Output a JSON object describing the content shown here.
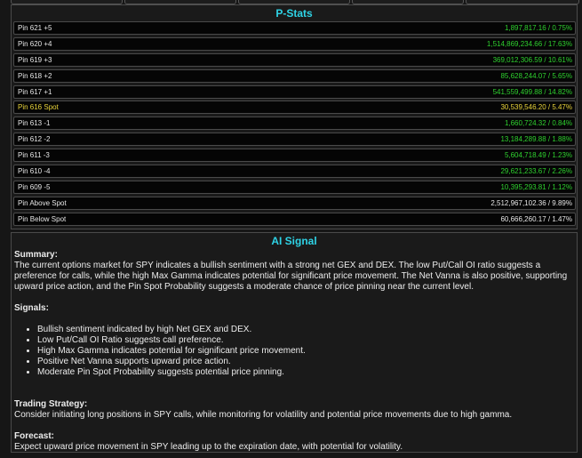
{
  "pstats": {
    "title": "P-Stats",
    "rows": [
      {
        "label": "Pin 621 +5",
        "value": "1,897,817.16 / 0.75%"
      },
      {
        "label": "Pin 620 +4",
        "value": "1,514,869,234.66 / 17.63%"
      },
      {
        "label": "Pin 619 +3",
        "value": "369,012,306.59 / 10.61%"
      },
      {
        "label": "Pin 618 +2",
        "value": "85,628,244.07 / 5.65%"
      },
      {
        "label": "Pin 617 +1",
        "value": "541,559,499.88 / 14.82%"
      },
      {
        "label": "Pin 616 Spot",
        "value": "30,539,546.20 / 5.47%"
      },
      {
        "label": "Pin 613 -1",
        "value": "1,660,724.32 / 0.84%"
      },
      {
        "label": "Pin 612 -2",
        "value": "13,184,289.88 / 1.88%"
      },
      {
        "label": "Pin 611 -3",
        "value": "5,604,718.49 / 1.23%"
      },
      {
        "label": "Pin 610 -4",
        "value": "29,621,233.67 / 2.26%"
      },
      {
        "label": "Pin 609 -5",
        "value": "10,395,293.81 / 1.12%"
      },
      {
        "label": "Pin Above Spot",
        "value": "2,512,967,102.36 / 9.89%"
      },
      {
        "label": "Pin Below Spot",
        "value": "60,666,260.17 / 1.47%"
      }
    ],
    "colors": {
      "positive": "#2fd12f",
      "spot": "#e8d33a",
      "neutral": "#e6e6e6",
      "title": "#2ed3e6"
    }
  },
  "ai_signal": {
    "title": "AI Signal",
    "summary_heading": "Summary:",
    "summary_text": "The current options market for SPY indicates a bullish sentiment with a strong net GEX and DEX. The low Put/Call OI ratio suggests a preference for calls, while the high Max Gamma indicates potential for significant price movement. The Net Vanna is also positive, supporting upward price action, and the Pin Spot Probability suggests a moderate chance of price pinning near the current level.",
    "signals_heading": "Signals:",
    "signals": [
      "Bullish sentiment indicated by high Net GEX and DEX.",
      "Low Put/Call OI Ratio suggests call preference.",
      "High Max Gamma indicates potential for significant price movement.",
      "Positive Net Vanna supports upward price action.",
      "Moderate Pin Spot Probability suggests potential price pinning."
    ],
    "strategy_heading": "Trading Strategy:",
    "strategy_text": "Consider initiating long positions in SPY calls, while monitoring for volatility and potential price movements due to high gamma.",
    "forecast_heading": "Forecast:",
    "forecast_text": "Expect upward price movement in SPY leading up to the expiration date, with potential for volatility."
  }
}
